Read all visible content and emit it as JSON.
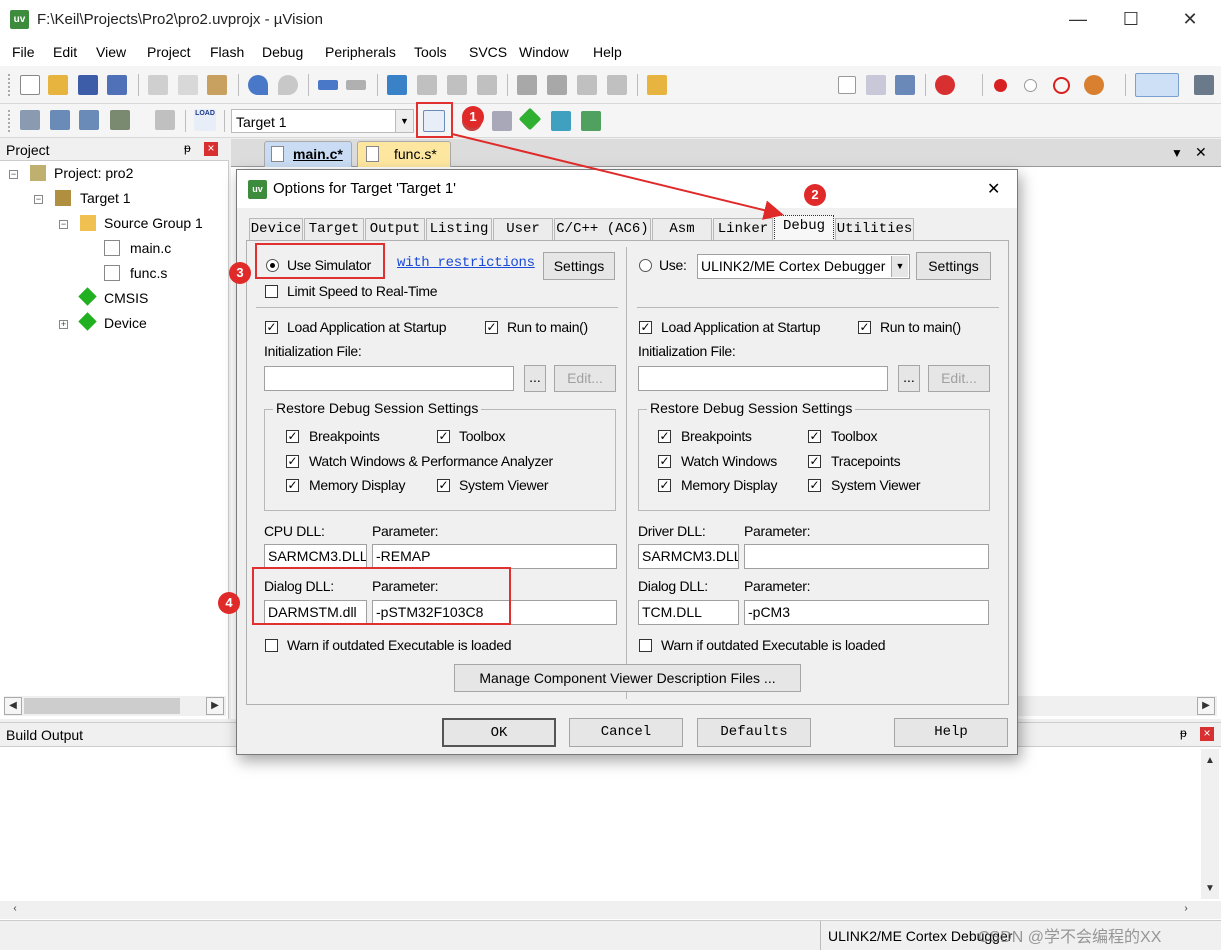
{
  "window": {
    "title": "F:\\Keil\\Projects\\Pro2\\pro2.uvprojx - µVision",
    "app_icon": "uv",
    "minimize_glyph": "—",
    "maximize_glyph": "☐",
    "close_glyph": "✕"
  },
  "menu": [
    "File",
    "Edit",
    "View",
    "Project",
    "Flash",
    "Debug",
    "Peripherals",
    "Tools",
    "SVCS",
    "Window",
    "Help"
  ],
  "toolbar2": {
    "target_select": "Target 1",
    "load_label": "LOAD"
  },
  "project_panel": {
    "title": "Project",
    "pin": "ᵽ",
    "close": "×",
    "tree": {
      "project": "Project: pro2",
      "target": "Target 1",
      "group": "Source Group 1",
      "file1": "main.c",
      "file2": "func.s",
      "cmsis": "CMSIS",
      "device": "Device"
    }
  },
  "editor": {
    "tabs": [
      "main.c*",
      "func.s*"
    ],
    "dropdown": "▼",
    "close": "✕"
  },
  "build_output": {
    "title": "Build Output",
    "pin": "ᵽ",
    "close": "×"
  },
  "status_bar": {
    "debugger": "ULINK2/ME Cortex Debugger",
    "watermark": "CSDN @学不会编程的XX"
  },
  "annotations": {
    "b1": "1",
    "b2": "2",
    "b3": "3",
    "b4": "4"
  },
  "dialog": {
    "title": "Options for Target 'Target 1'",
    "close": "✕",
    "tabs": [
      "Device",
      "Target",
      "Output",
      "Listing",
      "User",
      "C/C++ (AC6)",
      "Asm",
      "Linker",
      "Debug",
      "Utilities"
    ],
    "active_tab": "Debug",
    "left": {
      "use_simulator": "Use Simulator",
      "with_restrictions": "with restrictions",
      "settings": "Settings",
      "limit_speed": "Limit Speed to Real-Time",
      "load_app": "Load Application at Startup",
      "run_to_main": "Run to main()",
      "init_file": "Initialization File:",
      "browse": "...",
      "edit": "Edit...",
      "restore_group": "Restore Debug Session Settings",
      "breakpoints": "Breakpoints",
      "toolbox": "Toolbox",
      "watch_windows": "Watch Windows & Performance Analyzer",
      "memory_display": "Memory Display",
      "system_viewer": "System Viewer",
      "cpu_dll_label": "CPU DLL:",
      "cpu_param_label": "Parameter:",
      "cpu_dll": "SARMCM3.DLL",
      "cpu_param": "-REMAP",
      "dialog_dll_label": "Dialog DLL:",
      "dialog_param_label": "Parameter:",
      "dialog_dll": "DARMSTM.dll",
      "dialog_param": "-pSTM32F103C8",
      "warn": "Warn if outdated Executable is loaded"
    },
    "right": {
      "use": "Use:",
      "debugger": "ULINK2/ME Cortex Debugger",
      "settings": "Settings",
      "load_app": "Load Application at Startup",
      "run_to_main": "Run to main()",
      "init_file": "Initialization File:",
      "browse": "...",
      "edit": "Edit...",
      "restore_group": "Restore Debug Session Settings",
      "breakpoints": "Breakpoints",
      "toolbox": "Toolbox",
      "watch_windows": "Watch Windows",
      "tracepoints": "Tracepoints",
      "memory_display": "Memory Display",
      "system_viewer": "System Viewer",
      "driver_dll_label": "Driver DLL:",
      "driver_param_label": "Parameter:",
      "driver_dll": "SARMCM3.DLL",
      "driver_param": "",
      "dialog_dll_label": "Dialog DLL:",
      "dialog_param_label": "Parameter:",
      "dialog_dll": "TCM.DLL",
      "dialog_param": "-pCM3",
      "warn": "Warn if outdated Executable is loaded"
    },
    "manage_button": "Manage Component Viewer Description Files ...",
    "buttons": {
      "ok": "OK",
      "cancel": "Cancel",
      "defaults": "Defaults",
      "help": "Help"
    }
  },
  "colors": {
    "accent_red": "#e02a2a",
    "tab_yellow": "#fde7a0",
    "tab_blue": "#c9dcf3"
  }
}
